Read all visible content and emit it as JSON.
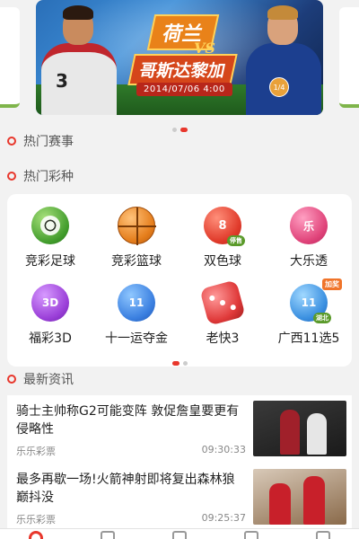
{
  "banner": {
    "team_home": "荷兰",
    "vs": "VS",
    "team_away": "哥斯达黎加",
    "match_time": "2014/07/06  4:00",
    "page_indicator": "1/4",
    "jersey_number": "3",
    "dots": 2,
    "active_dot": 1
  },
  "sections": {
    "hot_events": "热门赛事",
    "hot_lottery": "热门彩种",
    "latest_news": "最新资讯"
  },
  "lottery": [
    {
      "label": "竞彩足球",
      "icon": "football-icon",
      "ball_text": ""
    },
    {
      "label": "竞彩篮球",
      "icon": "basketball-icon",
      "ball_text": ""
    },
    {
      "label": "双色球",
      "icon": "double-color-ball-icon",
      "ball_text": "8",
      "sub": "停售"
    },
    {
      "label": "大乐透",
      "icon": "super-lotto-icon",
      "ball_text": "乐"
    },
    {
      "label": "福彩3D",
      "icon": "welfare-3d-icon",
      "ball_text": "3D"
    },
    {
      "label": "十一运夺金",
      "icon": "eleven-five-icon",
      "ball_text": "11"
    },
    {
      "label": "老快3",
      "icon": "dice-icon",
      "ball_text": ""
    },
    {
      "label": "广西11选5",
      "icon": "guangxi-11-5-icon",
      "ball_text": "11",
      "sub": "湖北",
      "badge": "加奖"
    }
  ],
  "grid_dots": {
    "count": 2,
    "active": 0
  },
  "news": [
    {
      "title": "骑士主帅称G2可能变阵 敦促詹皇要更有侵略性",
      "source": "乐乐彩票",
      "time": "09:30:33"
    },
    {
      "title": "最多再歇一场!火箭神射即将复出森林狼巅抖没",
      "source": "乐乐彩票",
      "time": "09:25:37"
    }
  ],
  "colors": {
    "accent": "#e8372c",
    "background": "#f2f2f2",
    "card": "#ffffff"
  }
}
